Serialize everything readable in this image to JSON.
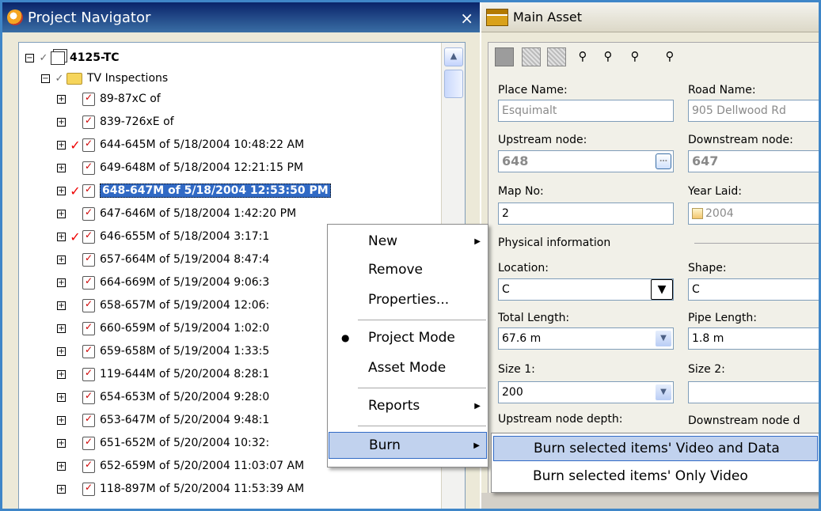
{
  "navigator": {
    "title": "Project Navigator",
    "close": "×",
    "tree": {
      "root": "4125-TC",
      "folder": "TV Inspections",
      "items": [
        {
          "label": "89-87xC of",
          "checked": false
        },
        {
          "label": "839-726xE of",
          "checked": false
        },
        {
          "label": "644-645M of 5/18/2004 10:48:22 AM",
          "checked": true
        },
        {
          "label": "649-648M of 5/18/2004 12:21:15 PM",
          "checked": false
        },
        {
          "label": "648-647M of 5/18/2004 12:53:50 PM",
          "checked": true,
          "selected": true
        },
        {
          "label": "647-646M of 5/18/2004 1:42:20 PM",
          "checked": false
        },
        {
          "label": "646-655M of 5/18/2004 3:17:1",
          "checked": true
        },
        {
          "label": "657-664M of 5/19/2004 8:47:4",
          "checked": false
        },
        {
          "label": "664-669M of 5/19/2004 9:06:3",
          "checked": false
        },
        {
          "label": "658-657M of 5/19/2004 12:06:",
          "checked": false
        },
        {
          "label": "660-659M of 5/19/2004 1:02:0",
          "checked": false
        },
        {
          "label": "659-658M of 5/19/2004 1:33:5",
          "checked": false
        },
        {
          "label": "119-644M of 5/20/2004 8:28:1",
          "checked": false
        },
        {
          "label": "654-653M of 5/20/2004 9:28:0",
          "checked": false
        },
        {
          "label": "653-647M of 5/20/2004 9:48:1",
          "checked": false
        },
        {
          "label": "651-652M of 5/20/2004 10:32:",
          "checked": false
        },
        {
          "label": "652-659M of 5/20/2004 11:03:07 AM",
          "checked": false
        },
        {
          "label": "118-897M of 5/20/2004 11:53:39 AM",
          "checked": false
        }
      ]
    }
  },
  "asset": {
    "title": "Main Asset",
    "place_name_label": "Place Name:",
    "place_name": "Esquimalt",
    "road_name_label": "Road Name:",
    "road_name": "905 Dellwood Rd",
    "upstream_label": "Upstream node:",
    "upstream": "648",
    "downstream_label": "Downstream node:",
    "downstream": "647",
    "map_no_label": "Map No:",
    "map_no": "2",
    "year_laid_label": "Year Laid:",
    "year_laid": "2004",
    "physical_label": "Physical information",
    "location_label": "Location:",
    "location": "C",
    "shape_label": "Shape:",
    "shape": "C",
    "total_length_label": "Total Length:",
    "total_length": "67.6 m",
    "pipe_length_label": "Pipe Length:",
    "pipe_length": "1.8 m",
    "size1_label": "Size 1:",
    "size1": "200",
    "size2_label": "Size 2:",
    "size2": "",
    "upstream_depth_label": "Upstream node depth:",
    "downstream_depth_label": "Downstream node d"
  },
  "context_menu": {
    "new": "New",
    "remove": "Remove",
    "properties": "Properties...",
    "project_mode": "Project Mode",
    "asset_mode": "Asset Mode",
    "reports": "Reports",
    "burn": "Burn"
  },
  "burn_submenu": {
    "video_and_data": "Burn selected items' Video and Data",
    "only_video": "Burn selected items' Only Video"
  }
}
